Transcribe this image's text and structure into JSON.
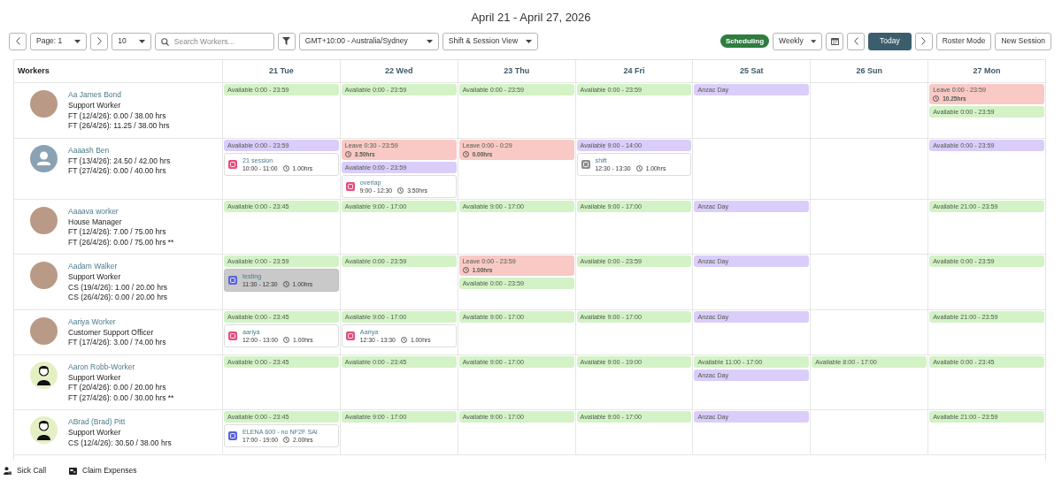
{
  "title": "April 21 - April 27, 2026",
  "toolbar_left": [
    {
      "kind": "prev"
    },
    {
      "kind": "select",
      "label": "Page: 1"
    },
    {
      "kind": "next"
    },
    {
      "kind": "select",
      "label": "10"
    },
    {
      "kind": "search",
      "placeholder": "Search Workers..."
    },
    {
      "kind": "filter"
    },
    {
      "kind": "select",
      "label": "GMT+10:00 - Australia/Sydney"
    },
    {
      "kind": "select",
      "label": "Shift & Session View"
    }
  ],
  "toolbar_right": [
    {
      "kind": "pill",
      "label": "Scheduling"
    },
    {
      "kind": "select",
      "label": "Weekly"
    },
    {
      "kind": "calendar"
    },
    {
      "kind": "prev"
    },
    {
      "kind": "primary",
      "label": "Today"
    },
    {
      "kind": "next"
    },
    {
      "kind": "button",
      "label": "Roster Mode"
    },
    {
      "kind": "button",
      "label": "New Session"
    }
  ],
  "table": {
    "workers_heading": "Workers",
    "days": [
      "21 Tue",
      "22 Wed",
      "23 Thu",
      "24 Fri",
      "25 Sat",
      "26 Sun",
      "27 Mon"
    ],
    "rows": [
      {
        "name": "Aa James Bond",
        "avatar": {
          "kind": "photo"
        },
        "lines": [
          "Support Worker",
          "FT (12/4/26): 0.00 / 38.00 hrs",
          "FT (26/4/26): 11.25 / 38.00 hrs"
        ],
        "days": {
          "tue": [
            {
              "kind": "block",
              "text": "Available 0:00 - 23:59",
              "color": "#d3f2c6"
            }
          ],
          "wed": [
            {
              "kind": "block",
              "text": "Available 0:00 - 23:59",
              "color": "#d3f2c6"
            }
          ],
          "thu": [
            {
              "kind": "block",
              "text": "Available 0:00 - 23:59",
              "color": "#d3f2c6"
            }
          ],
          "fri": [
            {
              "kind": "block",
              "text": "Available 0:00 - 23:59",
              "color": "#d3f2c6"
            }
          ],
          "sat": [
            {
              "kind": "block",
              "text": "Anzac Day",
              "color": "#dacdf9"
            }
          ],
          "mon": [
            {
              "kind": "block",
              "text": "Leave 0:00 - 23:59",
              "hours": "10.25hrs",
              "color": "#f8c9c5"
            },
            {
              "kind": "block",
              "text": "Available 0:00 - 23:59",
              "color": "#d3f2c6"
            }
          ]
        }
      },
      {
        "name": "Aaaash Ben",
        "avatar": {
          "kind": "default"
        },
        "lines": [
          "FT (13/4/26): 24.50 / 42.00 hrs",
          "FT (27/4/26): 0.00 / 40.00 hrs"
        ],
        "days": {
          "tue": [
            {
              "kind": "block",
              "text": "Available 0:00 - 23:59",
              "color": "#dacdf9"
            },
            {
              "kind": "session",
              "title": "21 session",
              "time": "10:00 - 11:00",
              "hours": "1.00hrs",
              "color": "#e94b7b",
              "shaded": false
            }
          ],
          "wed": [
            {
              "kind": "block",
              "text": "Leave 0:30 - 23:59",
              "hours": "3.50hrs",
              "color": "#f8c9c5"
            },
            {
              "kind": "block",
              "text": "Available 0:00 - 23:59",
              "color": "#dacdf9"
            },
            {
              "kind": "session",
              "title": "overlap",
              "time": "9:00 - 12:30",
              "hours": "3.50hrs",
              "color": "#e94b7b",
              "shaded": false
            }
          ],
          "thu": [
            {
              "kind": "block",
              "text": "Leave 0:00 - 0:29",
              "hours": "0.00hrs",
              "color": "#f8c9c5"
            }
          ],
          "fri": [
            {
              "kind": "block",
              "text": "Available 9:00 - 14:00",
              "color": "#dacdf9"
            },
            {
              "kind": "session",
              "title": "shift",
              "time": "12:30 - 13:30",
              "hours": "1.00hrs",
              "color": "#8c8c8c",
              "shaded": false
            }
          ],
          "mon": [
            {
              "kind": "block",
              "text": "Available 0:00 - 23:59",
              "color": "#dacdf9"
            }
          ]
        }
      },
      {
        "name": "Aaaava worker",
        "avatar": {
          "kind": "photo"
        },
        "lines": [
          "House Manager",
          "FT (12/4/26): 7.00 / 75.00 hrs",
          "FT (26/4/26): 0.00 / 75.00 hrs **"
        ],
        "days": {
          "tue": [
            {
              "kind": "block",
              "text": "Available 0:00 - 23:45",
              "color": "#d3f2c6"
            }
          ],
          "wed": [
            {
              "kind": "block",
              "text": "Available 9:00 - 17:00",
              "color": "#d3f2c6"
            }
          ],
          "thu": [
            {
              "kind": "block",
              "text": "Available 9:00 - 17:00",
              "color": "#d3f2c6"
            }
          ],
          "fri": [
            {
              "kind": "block",
              "text": "Available 9:00 - 17:00",
              "color": "#d3f2c6"
            }
          ],
          "sat": [
            {
              "kind": "block",
              "text": "Anzac Day",
              "color": "#dacdf9"
            }
          ],
          "mon": [
            {
              "kind": "block",
              "text": "Available 21:00 - 23:59",
              "color": "#d3f2c6"
            }
          ]
        }
      },
      {
        "name": "Aadam Walker",
        "avatar": {
          "kind": "photo"
        },
        "lines": [
          "Support Worker",
          "CS (19/4/26): 1.00 / 20.00 hrs",
          "CS (26/4/26): 0.00 / 20.00 hrs"
        ],
        "days": {
          "tue": [
            {
              "kind": "block",
              "text": "Available 0:00 - 23:59",
              "color": "#d3f2c6"
            },
            {
              "kind": "session",
              "title": "testing",
              "time": "11:30 - 12:30",
              "hours": "1.00hrs",
              "color": "#5a63d9",
              "shaded": true
            }
          ],
          "wed": [
            {
              "kind": "block",
              "text": "Available 0:00 - 23:59",
              "color": "#d3f2c6"
            }
          ],
          "thu": [
            {
              "kind": "block",
              "text": "Leave 0:00 - 23:59",
              "hours": "1.00hrs",
              "color": "#f8c9c5"
            },
            {
              "kind": "block",
              "text": "Available 0:00 - 23:59",
              "color": "#d3f2c6"
            }
          ],
          "fri": [
            {
              "kind": "block",
              "text": "Available 0:00 - 23:59",
              "color": "#d3f2c6"
            }
          ],
          "sat": [
            {
              "kind": "block",
              "text": "Anzac Day",
              "color": "#dacdf9"
            }
          ],
          "mon": [
            {
              "kind": "block",
              "text": "Available 0:00 - 23:59",
              "color": "#d3f2c6"
            }
          ]
        }
      },
      {
        "name": "Aariya Worker",
        "avatar": {
          "kind": "photo"
        },
        "lines": [
          "Customer Support Officer",
          "FT (17/4/26): 3.00 / 74.00 hrs"
        ],
        "days": {
          "tue": [
            {
              "kind": "block",
              "text": "Available 0:00 - 23:45",
              "color": "#d3f2c6"
            },
            {
              "kind": "session",
              "title": "aariya",
              "time": "12:00 - 13:00",
              "hours": "1.00hrs",
              "color": "#e94b7b",
              "shaded": false
            }
          ],
          "wed": [
            {
              "kind": "block",
              "text": "Available 9:00 - 17:00",
              "color": "#d3f2c6"
            },
            {
              "kind": "session",
              "title": "Aariya",
              "time": "12:30 - 13:30",
              "hours": "1.00hrs",
              "color": "#e94b7b",
              "shaded": false
            }
          ],
          "thu": [
            {
              "kind": "block",
              "text": "Available 9:00 - 17:00",
              "color": "#d3f2c6"
            }
          ],
          "fri": [
            {
              "kind": "block",
              "text": "Available 9:00 - 17:00",
              "color": "#d3f2c6"
            }
          ],
          "sat": [
            {
              "kind": "block",
              "text": "Anzac Day",
              "color": "#dacdf9"
            }
          ],
          "mon": [
            {
              "kind": "block",
              "text": "Available 21:00 - 23:59",
              "color": "#d3f2c6"
            }
          ]
        }
      },
      {
        "name": "Aaron Robb-Worker",
        "avatar": {
          "kind": "illustration"
        },
        "lines": [
          "Support Worker",
          "FT (20/4/26): 0.00 / 20.00 hrs",
          "FT (27/4/26): 0.00 / 30.00 hrs **"
        ],
        "days": {
          "tue": [
            {
              "kind": "block",
              "text": "Available 0:00 - 23:45",
              "color": "#d3f2c6"
            }
          ],
          "wed": [
            {
              "kind": "block",
              "text": "Available 0:00 - 23:45",
              "color": "#d3f2c6"
            }
          ],
          "thu": [
            {
              "kind": "block",
              "text": "Available 9:00 - 17:00",
              "color": "#d3f2c6"
            }
          ],
          "fri": [
            {
              "kind": "block",
              "text": "Available 9:00 - 19:00",
              "color": "#d3f2c6"
            }
          ],
          "sat": [
            {
              "kind": "block",
              "text": "Available 11:00 - 17:00",
              "color": "#d3f2c6"
            },
            {
              "kind": "block",
              "text": "Anzac Day",
              "color": "#dacdf9"
            }
          ],
          "sun": [
            {
              "kind": "block",
              "text": "Available 8:00 - 17:00",
              "color": "#d3f2c6"
            }
          ],
          "mon": [
            {
              "kind": "block",
              "text": "Available 0:00 - 23:45",
              "color": "#d3f2c6"
            }
          ]
        }
      },
      {
        "name": "ABrad (Brad) Pitt",
        "avatar": {
          "kind": "illustration"
        },
        "lines": [
          "Support Worker",
          "CS (12/4/26): 30.50 / 38.00 hrs"
        ],
        "days": {
          "tue": [
            {
              "kind": "block",
              "text": "Available 0:00 - 23:45",
              "color": "#d3f2c6"
            },
            {
              "kind": "session",
              "title": "ELENA 600 - no NF2F SAi",
              "time": "17:00 - 19:00",
              "hours": "2.00hrs",
              "color": "#5a63d9",
              "shaded": false
            }
          ],
          "wed": [
            {
              "kind": "block",
              "text": "Available 9:00 - 17:00",
              "color": "#d3f2c6"
            }
          ],
          "thu": [
            {
              "kind": "block",
              "text": "Available 9:00 - 17:00",
              "color": "#d3f2c6"
            }
          ],
          "fri": [
            {
              "kind": "block",
              "text": "Available 9:00 - 17:00",
              "color": "#d3f2c6"
            }
          ],
          "sat": [
            {
              "kind": "block",
              "text": "Anzac Day",
              "color": "#dacdf9"
            }
          ],
          "mon": [
            {
              "kind": "block",
              "text": "Available 21:00 - 23:59",
              "color": "#d3f2c6"
            }
          ]
        }
      }
    ]
  },
  "footer": [
    {
      "kind": "sick",
      "label": "Sick Call"
    },
    {
      "kind": "expense",
      "label": "Claim Expenses"
    }
  ]
}
